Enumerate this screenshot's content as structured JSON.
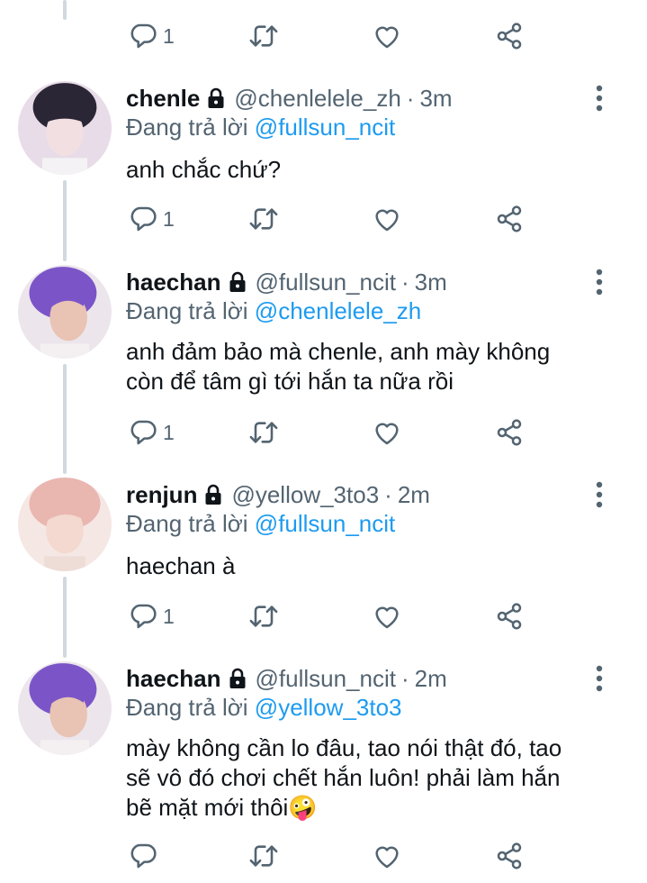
{
  "reply_prefix": "Đang trả lời",
  "colors": {
    "accent": "#1d9bf0",
    "muted": "#536471",
    "thread": "#cfd9de"
  },
  "top_actions": {
    "reply_count": "1"
  },
  "tweets": [
    {
      "name": "chenle",
      "handle": "@chenlelele_zh",
      "time": "3m",
      "reply_to": "@fullsun_ncit",
      "text": "anh chắc chứ?",
      "reply_count": "1"
    },
    {
      "name": "haechan",
      "handle": "@fullsun_ncit",
      "time": "3m",
      "reply_to": "@chenlelele_zh",
      "text_lines": [
        "anh đảm bảo mà chenle, anh mày không",
        "còn để tâm gì tới hắn ta nữa rồi"
      ],
      "reply_count": "1"
    },
    {
      "name": "renjun",
      "handle": "@yellow_3to3",
      "time": "2m",
      "reply_to": "@fullsun_ncit",
      "text": "haechan à",
      "reply_count": "1"
    },
    {
      "name": "haechan",
      "handle": "@fullsun_ncit",
      "time": "2m",
      "reply_to": "@yellow_3to3",
      "text_lines": [
        "mày không cần lo đâu, tao nói thật đó, tao",
        "sẽ vô đó chơi chết hắn luôn! phải làm hắn",
        "bẽ mặt mới thôi🤪"
      ],
      "reply_count": ""
    }
  ]
}
